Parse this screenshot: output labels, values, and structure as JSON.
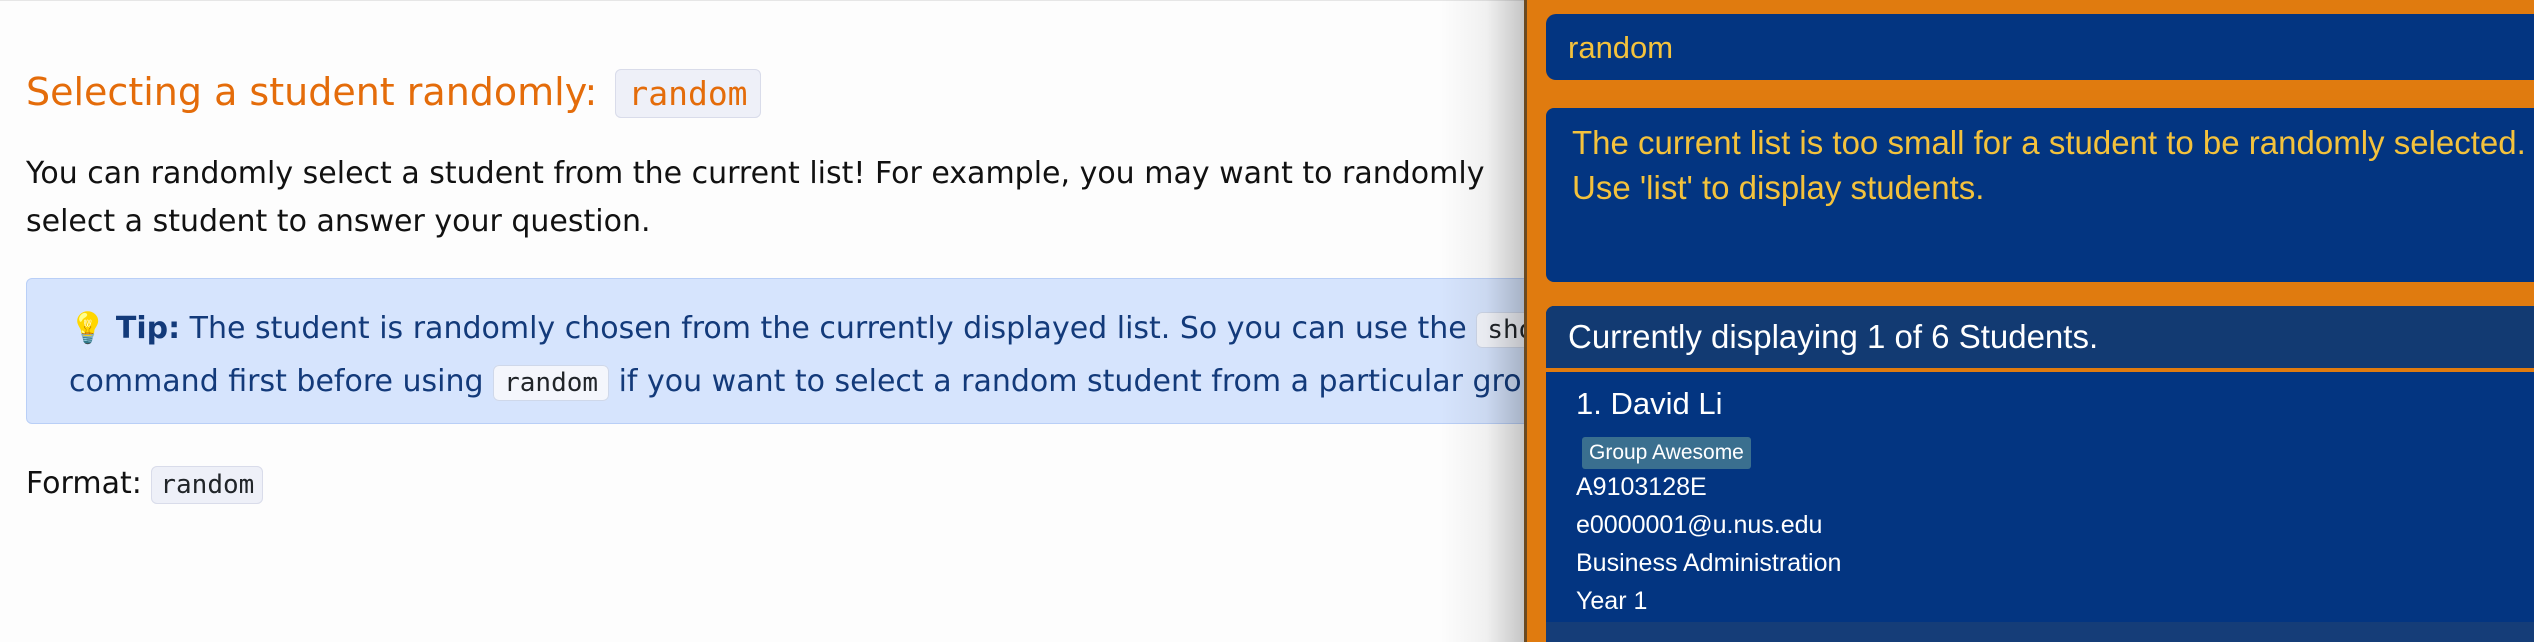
{
  "doc": {
    "heading_text": "Selecting a student randomly:",
    "heading_code": "random",
    "paragraph": "You can randomly select a student from the current list! For example, you may want to randomly select a student to answer your question.",
    "tip": {
      "icon": "💡",
      "label": "Tip:",
      "text_1": "The student is randomly chosen from the currently displayed list. So you can use the",
      "code_1": "show",
      "text_2": "command first before using",
      "code_2": "random",
      "text_3": "if you want to select a random student from a particular group."
    },
    "format_label": "Format:",
    "format_code": "random"
  },
  "app": {
    "command_input": "random",
    "result_message": "The current list is too small for a student to be randomly selected. Use 'list' to display students.",
    "list_header": "Currently displaying 1 of 6 Students.",
    "students": [
      {
        "name": "1. David Li",
        "tag": "Group Awesome",
        "student_id": "A9103128E",
        "email": "e0000001@u.nus.edu",
        "major": "Business Administration",
        "year": "Year 1"
      }
    ]
  },
  "colors": {
    "heading_orange": "#e46c0a",
    "app_background": "#e07b0f",
    "panel_blue": "#033581",
    "result_text_yellow": "#f4c23c",
    "tip_background": "#d6e4fd"
  }
}
